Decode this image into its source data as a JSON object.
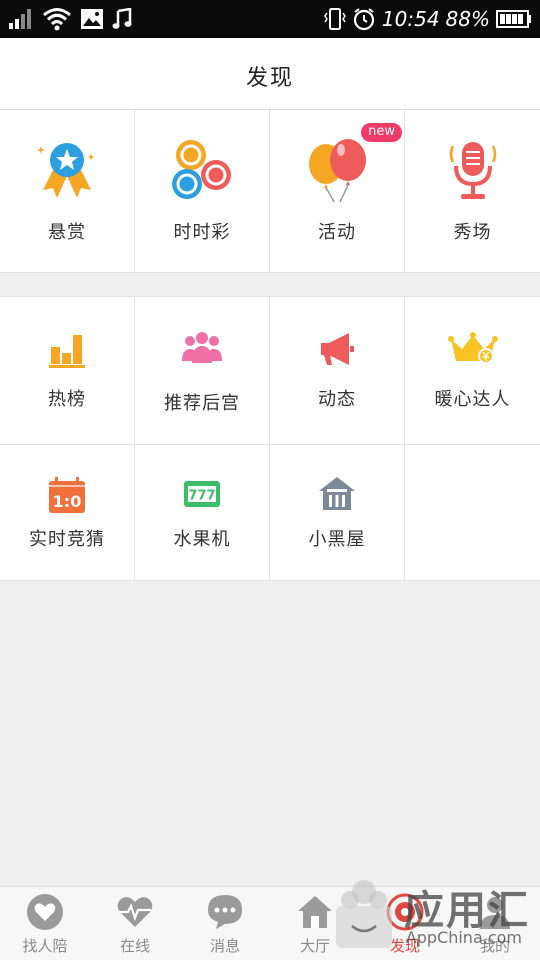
{
  "status_bar": {
    "time": "10:54",
    "battery": "88%",
    "icons": [
      "signal-icon",
      "wifi-icon",
      "image-icon",
      "music-icon",
      "vibrate-icon",
      "alarm-icon",
      "battery-icon"
    ]
  },
  "header": {
    "title": "发现"
  },
  "grid1": [
    {
      "label": "悬赏",
      "icon": "reward-ribbon-icon"
    },
    {
      "label": "时时彩",
      "icon": "lottery-balls-icon"
    },
    {
      "label": "活动",
      "icon": "balloons-icon",
      "badge": "new"
    },
    {
      "label": "秀场",
      "icon": "microphone-icon"
    }
  ],
  "grid2": [
    {
      "label": "热榜",
      "icon": "bar-chart-icon"
    },
    {
      "label": "推荐后宫",
      "icon": "people-group-icon"
    },
    {
      "label": "动态",
      "icon": "megaphone-icon"
    },
    {
      "label": "暖心达人",
      "icon": "crown-icon"
    },
    {
      "label": "实时竞猜",
      "icon": "scoreboard-icon",
      "score": "1:0"
    },
    {
      "label": "水果机",
      "icon": "slot-machine-icon",
      "digits": "777"
    },
    {
      "label": "小黑屋",
      "icon": "small-house-icon"
    }
  ],
  "nav": [
    {
      "label": "找人陪",
      "icon": "heart-bubble-icon"
    },
    {
      "label": "在线",
      "icon": "heartbeat-icon"
    },
    {
      "label": "消息",
      "icon": "chat-icon"
    },
    {
      "label": "大厅",
      "icon": "home-icon"
    },
    {
      "label": "发现",
      "icon": "discover-icon",
      "active": true
    },
    {
      "label": "我的",
      "icon": "user-icon"
    }
  ],
  "watermark": {
    "text": "应用汇",
    "sub": "AppChina.com"
  },
  "colors": {
    "accent": "#e2473f",
    "badge": "#ef3b6a",
    "nav_inactive": "#8a8a8a"
  }
}
